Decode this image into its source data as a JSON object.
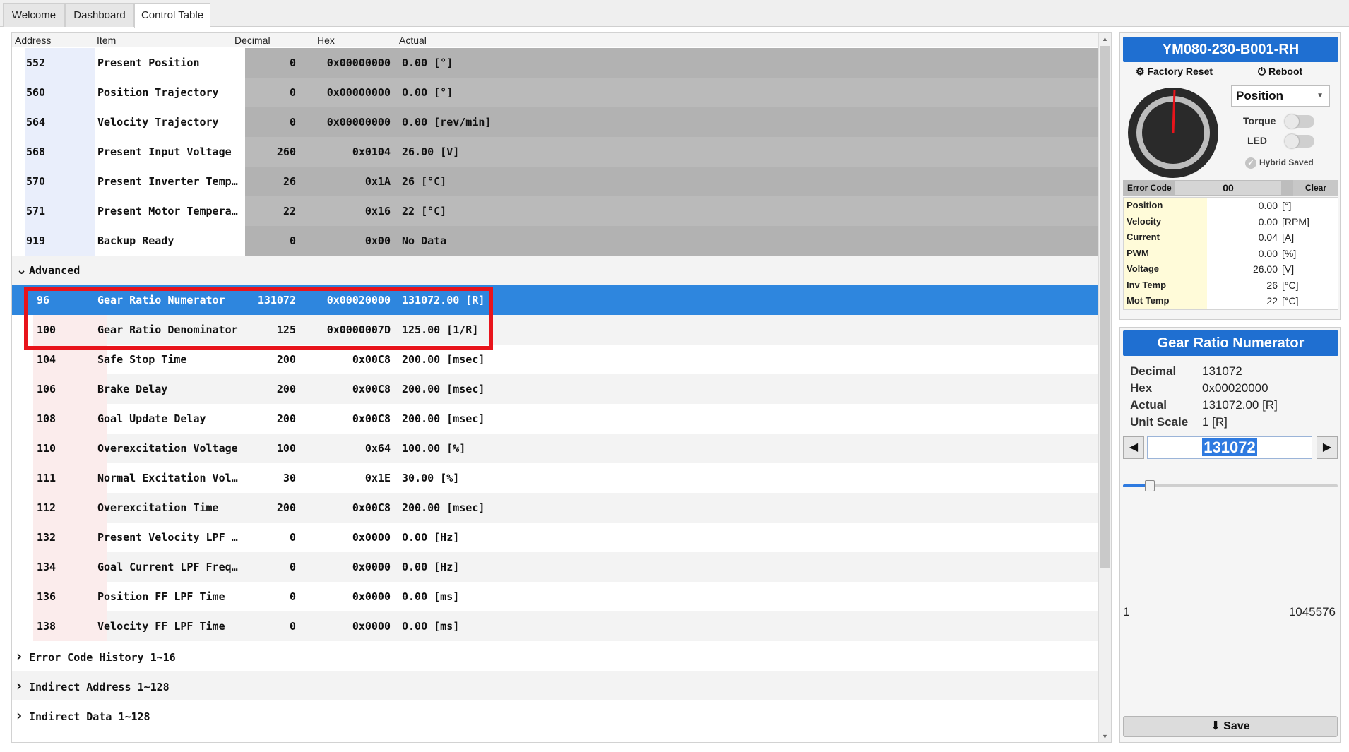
{
  "tabs": [
    {
      "label": "Welcome"
    },
    {
      "label": "Dashboard"
    },
    {
      "label": "Control Table",
      "active": true
    }
  ],
  "table": {
    "headers": {
      "address": "Address",
      "item": "Item",
      "decimal": "Decimal",
      "hex": "Hex",
      "actual": "Actual"
    },
    "status_rows": [
      {
        "address": "552",
        "item": "Present Position",
        "decimal": "0",
        "hex": "0x00000000",
        "actual": "0.00 [°]"
      },
      {
        "address": "560",
        "item": "Position Trajectory",
        "decimal": "0",
        "hex": "0x00000000",
        "actual": "0.00 [°]"
      },
      {
        "address": "564",
        "item": "Velocity Trajectory",
        "decimal": "0",
        "hex": "0x00000000",
        "actual": "0.00 [rev/min]"
      },
      {
        "address": "568",
        "item": "Present Input Voltage",
        "decimal": "260",
        "hex": "0x0104",
        "actual": "26.00 [V]"
      },
      {
        "address": "570",
        "item": "Present Inverter Temp…",
        "decimal": "26",
        "hex": "0x1A",
        "actual": "26 [°C]"
      },
      {
        "address": "571",
        "item": "Present Motor Tempera…",
        "decimal": "22",
        "hex": "0x16",
        "actual": "22 [°C]"
      },
      {
        "address": "919",
        "item": "Backup Ready",
        "decimal": "0",
        "hex": "0x00",
        "actual": "No Data"
      }
    ],
    "advanced_group": {
      "label": "Advanced"
    },
    "advanced_rows": [
      {
        "address": "96",
        "item": "Gear Ratio Numerator",
        "decimal": "131072",
        "hex": "0x00020000",
        "actual": "131072.00 [R]"
      },
      {
        "address": "100",
        "item": "Gear Ratio Denominator",
        "decimal": "125",
        "hex": "0x0000007D",
        "actual": "125.00 [1/R]"
      },
      {
        "address": "104",
        "item": "Safe Stop Time",
        "decimal": "200",
        "hex": "0x00C8",
        "actual": "200.00 [msec]"
      },
      {
        "address": "106",
        "item": "Brake Delay",
        "decimal": "200",
        "hex": "0x00C8",
        "actual": "200.00 [msec]"
      },
      {
        "address": "108",
        "item": "Goal Update Delay",
        "decimal": "200",
        "hex": "0x00C8",
        "actual": "200.00 [msec]"
      },
      {
        "address": "110",
        "item": "Overexcitation Voltage",
        "decimal": "100",
        "hex": "0x64",
        "actual": "100.00 [%]"
      },
      {
        "address": "111",
        "item": "Normal Excitation Vol…",
        "decimal": "30",
        "hex": "0x1E",
        "actual": "30.00 [%]"
      },
      {
        "address": "112",
        "item": "Overexcitation Time",
        "decimal": "200",
        "hex": "0x00C8",
        "actual": "200.00 [msec]"
      },
      {
        "address": "132",
        "item": "Present Velocity LPF …",
        "decimal": "0",
        "hex": "0x0000",
        "actual": "0.00 [Hz]"
      },
      {
        "address": "134",
        "item": "Goal Current LPF Freq…",
        "decimal": "0",
        "hex": "0x0000",
        "actual": "0.00 [Hz]"
      },
      {
        "address": "136",
        "item": "Position FF LPF Time",
        "decimal": "0",
        "hex": "0x0000",
        "actual": "0.00 [ms]"
      },
      {
        "address": "138",
        "item": "Velocity FF LPF Time",
        "decimal": "0",
        "hex": "0x0000",
        "actual": "0.00 [ms]"
      }
    ],
    "collapsed_groups": [
      {
        "label": "Error Code History 1~16"
      },
      {
        "label": "Indirect Address 1~128"
      },
      {
        "label": "Indirect Data 1~128"
      }
    ]
  },
  "device": {
    "model": "YM080-230-B001-RH",
    "factory_reset_label": "Factory Reset",
    "reboot_label": "Reboot",
    "mode": "Position",
    "torque_label": "Torque",
    "led_label": "LED",
    "torque_on": false,
    "led_on": false,
    "hybrid_saved_label": "Hybrid Saved",
    "error_code_label": "Error Code",
    "error_code_value": "00",
    "clear_label": "Clear",
    "stats": [
      {
        "label": "Position",
        "value": "0.00",
        "unit": "[°]"
      },
      {
        "label": "Velocity",
        "value": "0.00",
        "unit": "[RPM]"
      },
      {
        "label": "Current",
        "value": "0.04",
        "unit": "[A]"
      },
      {
        "label": "PWM",
        "value": "0.00",
        "unit": "[%]"
      },
      {
        "label": "Voltage",
        "value": "26.00",
        "unit": "[V]"
      },
      {
        "label": "Inv Temp",
        "value": "26",
        "unit": "[°C]"
      },
      {
        "label": "Mot Temp",
        "value": "22",
        "unit": "[°C]"
      }
    ]
  },
  "detail": {
    "title": "Gear Ratio Numerator",
    "decimal_label": "Decimal",
    "decimal_value": "131072",
    "hex_label": "Hex",
    "hex_value": "0x00020000",
    "actual_label": "Actual",
    "actual_value": "131072.00 [R]",
    "unit_scale_label": "Unit Scale",
    "unit_scale_value": "1 [R]",
    "input_value": "131072",
    "slider_fraction": 0.125,
    "range_min": "1",
    "range_max": "1045576",
    "save_label": "Save"
  },
  "colors": {
    "accent": "#1f6fd1",
    "selection": "#2e86de",
    "highlight_box": "#e8141b",
    "readonly_value_bg": "#b2b2b2"
  }
}
